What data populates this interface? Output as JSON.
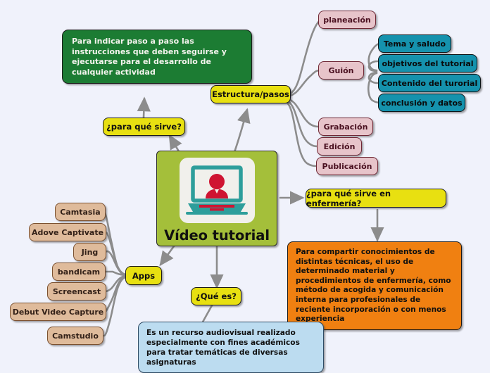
{
  "diagram": {
    "type": "mind-map",
    "title": "Vídeo tutorial",
    "background_color": "#f0f2fb",
    "palette": {
      "center": "#a4bf3a",
      "key_node": "#e8e011",
      "green_note": "#1c7c33",
      "orange_note": "#f08011",
      "blue_note": "#bcdcf0",
      "pink_node": "#e7c4ca",
      "teal_node": "#1592ad",
      "tan_node": "#dfbb9b",
      "connector": "#8c8c8c"
    },
    "center": {
      "label": "Vídeo tutorial",
      "icon": "laptop-with-person-icon"
    },
    "notes": {
      "purpose": "Para indicar paso a paso las instrucciones que deben seguirse y ejecutarse para el desarrollo de cualquier actividad",
      "nursing": "Para compartir conocimientos de distintas técnicas, el uso de determinado material y procedimientos de enfermería, como método de acogida y comunicación interna para profesionales de reciente incorporación o con menos experiencia",
      "definition": "Es un recurso audiovisual realizado especialmente con fines académicos para tratar temáticas de diversas asignaturas"
    },
    "key_nodes": {
      "purpose": "¿para qué sirve?",
      "structure": "Estructura/pasos",
      "nursing": "¿para qué sirve en enfermería?",
      "apps": "Apps",
      "definition": "¿Qué es?"
    },
    "structure_steps": [
      {
        "label": "planeación"
      },
      {
        "label": "Guión"
      },
      {
        "label": "Grabación"
      },
      {
        "label": "Edición"
      },
      {
        "label": "Publicación"
      }
    ],
    "script_parts": [
      {
        "label": "Tema y saludo"
      },
      {
        "label": "objetivos del tutorial"
      },
      {
        "label": "Contenido del turorial"
      },
      {
        "label": "conclusión y datos"
      }
    ],
    "apps": [
      {
        "label": "Camtasia"
      },
      {
        "label": "Adove Captivate"
      },
      {
        "label": "Jing"
      },
      {
        "label": "bandicam"
      },
      {
        "label": "Screencast"
      },
      {
        "label": "Debut Video Capture"
      },
      {
        "label": "Camstudio"
      }
    ]
  }
}
